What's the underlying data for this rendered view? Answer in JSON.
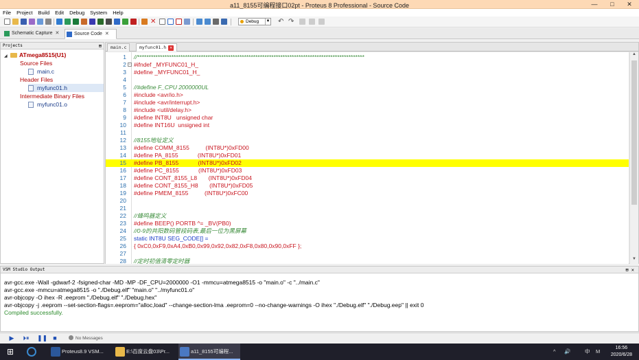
{
  "window": {
    "title": "a11_8155可编程接口02pt - Proteus 8 Professional - Source Code",
    "controls": [
      "—",
      "□",
      "✕"
    ]
  },
  "menu": [
    "File",
    "Project",
    "Build",
    "Edit",
    "Debug",
    "System",
    "Help"
  ],
  "toolbar": {
    "config_value": "Debug",
    "icons": [
      "new-icon",
      "open-icon",
      "save-icon",
      "import-icon",
      "export-icon",
      "close-project-icon",
      "home-icon",
      "schematic-icon",
      "pcb-icon",
      "3d-icon",
      "gerber-icon",
      "bom-icon",
      "design-explorer-icon",
      "source-code-icon",
      "build-icon",
      "rebuild-icon",
      "clean-icon",
      "stop-icon",
      "new-file-icon",
      "add-file-icon",
      "remove-file-icon",
      "find-icon",
      "copy-icon",
      "paste-icon",
      "settings-icon",
      "undo-icon",
      "redo-icon",
      "cut-icon",
      "copy2-icon",
      "paste2-icon",
      "help-icon"
    ]
  },
  "doc_tabs": [
    {
      "label": "Schematic Capture",
      "icon": "schematic-icon"
    },
    {
      "label": "Source Code",
      "icon": "source-code-icon"
    }
  ],
  "projects": {
    "header": "Projects",
    "tree": [
      {
        "label": "ATmega8515(U1)",
        "kind": "root"
      },
      {
        "label": "Source Files",
        "kind": "folder"
      },
      {
        "label": "main.c",
        "kind": "file"
      },
      {
        "label": "Header Files",
        "kind": "folder"
      },
      {
        "label": "myfunc01.h",
        "kind": "file"
      },
      {
        "label": "Intermediate Binary Files",
        "kind": "folder"
      },
      {
        "label": "myfunc01.o",
        "kind": "file"
      }
    ]
  },
  "editor_tabs": [
    {
      "label": "main.c"
    },
    {
      "label": "myfunc01.h"
    }
  ],
  "code_lines": [
    {
      "n": "1",
      "t": "//****************************************************************************************************",
      "c": "c-cmt"
    },
    {
      "n": "2",
      "t": "#ifndef _MYFUNC01_H_",
      "c": "c-pp"
    },
    {
      "n": "3",
      "t": "#define _MYFUNC01_H_",
      "c": "c-pp"
    },
    {
      "n": "4",
      "t": "",
      "c": "c-pp"
    },
    {
      "n": "5",
      "t": "//#define F_CPU 2000000UL",
      "c": "c-cmt"
    },
    {
      "n": "6",
      "t": "#include <avr/io.h>",
      "c": "c-pp"
    },
    {
      "n": "7",
      "t": "#include <avr/interrupt.h>",
      "c": "c-pp"
    },
    {
      "n": "8",
      "t": "#include <util/delay.h>",
      "c": "c-pp"
    },
    {
      "n": "9",
      "t": "#define INT8U   unsigned char",
      "c": "c-pp"
    },
    {
      "n": "10",
      "t": "#define INT16U  unsigned int",
      "c": "c-pp"
    },
    {
      "n": "11",
      "t": "",
      "c": "c-pp"
    },
    {
      "n": "12",
      "t": "//8155地址定义",
      "c": "c-cmt"
    },
    {
      "n": "13",
      "t": "#define COMM_8155          (INT8U*)0xFD00",
      "c": "c-pp"
    },
    {
      "n": "14",
      "t": "#define PA_8155            (INT8U*)0xFD01",
      "c": "c-pp"
    },
    {
      "n": "15",
      "t": "#define PB_8155            (INT8U*)0xFD02",
      "c": "c-pp"
    },
    {
      "n": "16",
      "t": "#define PC_8155            (INT8U*)0xFD03",
      "c": "c-pp"
    },
    {
      "n": "17",
      "t": "#define CONT_8155_L8       (INT8U*)0xFD04",
      "c": "c-pp"
    },
    {
      "n": "18",
      "t": "#define CONT_8155_H8       (INT8U*)0xFD05",
      "c": "c-pp"
    },
    {
      "n": "19",
      "t": "#define PMEM_8155          (INT8U*)0xFC00",
      "c": "c-pp"
    },
    {
      "n": "20",
      "t": "",
      "c": "c-pp"
    },
    {
      "n": "21",
      "t": "",
      "c": "c-pp"
    },
    {
      "n": "22",
      "t": "//蜂鸣器定义",
      "c": "c-cmt"
    },
    {
      "n": "23",
      "t": "#define BEEP() PORTB ^= _BV(PB0)",
      "c": "c-pp"
    },
    {
      "n": "24",
      "t": "//0-9的共阳数码管段码表,最后一位为黑屏幕",
      "c": "c-cmt"
    },
    {
      "n": "25",
      "t": "static INT8U SEG_CODE[] =",
      "c": "c-kw"
    },
    {
      "n": "26",
      "t": "{ 0xC0,0xF9,0xA4,0xB0,0x99,0x92,0x82,0xF8,0x80,0x90,0xFF };",
      "c": "c-txt"
    },
    {
      "n": "27",
      "t": "",
      "c": "c-pp"
    },
    {
      "n": "28",
      "t": "//定时初值清零定时器",
      "c": "c-cmt"
    }
  ],
  "highlighted_line": "15",
  "output": {
    "header": "VSM Studio Output",
    "lines": [
      "avr-gcc.exe -Wall -gdwarf-2 -fsigned-char -MD -MP -DF_CPU=2000000 -O1 -mmcu=atmega8515  -o \"main.o\" -c \"../main.c\"",
      "avr-gcc.exe -mmcu=atmega8515  -o \"./Debug.elf\" \"main.o\" \"../myfunc01.o\"",
      "avr-objcopy -O ihex -R .eeprom \"./Debug.elf\" \"./Debug.hex\"",
      "avr-objcopy -j .eeprom --set-section-flags=.eeprom=\"alloc,load\" --change-section-lma .eeprom=0 --no-change-warnings -O ihex \"./Debug.elf\" \"./Debug.eep\" || exit 0"
    ],
    "success": "Compiled successfully."
  },
  "status": {
    "controls": [
      "play-icon",
      "step-icon",
      "pause-icon",
      "stop-icon"
    ],
    "message": "No Messages"
  },
  "taskbar": {
    "tasks": [
      {
        "label": "Proteus8.9 VSM...",
        "icon": "word-icon",
        "color": "#2b579a"
      },
      {
        "label": "E:\\百度云盘03\\Pr...",
        "icon": "folder-icon",
        "color": "#e8b84a"
      },
      {
        "label": "a11_8155可编程...",
        "icon": "proteus-icon",
        "color": "#4a78c2"
      }
    ],
    "tray": [
      "^",
      "🔊",
      "中",
      "M"
    ],
    "time": "16:56",
    "date": "2020/6/28"
  }
}
